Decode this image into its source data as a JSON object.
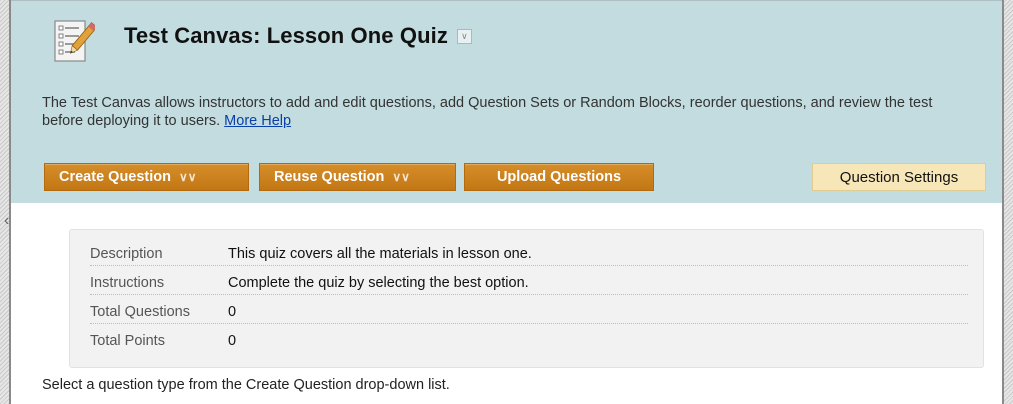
{
  "header": {
    "title": "Test Canvas: Lesson One Quiz",
    "title_menu_icon": "double-chevron-down-icon",
    "description": "The Test Canvas allows instructors to add and edit questions, add Question Sets or Random Blocks, reorder questions, and review the test before deploying it to users.",
    "help_link": "More Help"
  },
  "toolbar": {
    "create_label": "Create Question",
    "reuse_label": "Reuse Question",
    "upload_label": "Upload Questions",
    "settings_label": "Question Settings"
  },
  "info": {
    "rows": [
      {
        "label": "Description",
        "value": "This quiz covers all the materials in lesson one."
      },
      {
        "label": "Instructions",
        "value": "Complete the quiz by selecting the best option."
      },
      {
        "label": "Total Questions",
        "value": "0"
      },
      {
        "label": "Total Points",
        "value": "0"
      }
    ]
  },
  "footer": {
    "note": "Select a question type from the Create Question drop-down list."
  },
  "colors": {
    "header_bg": "#c2dce0",
    "accent_button": "#c98120",
    "settings_button": "#f7e7b8",
    "link": "#0b3fa8"
  }
}
